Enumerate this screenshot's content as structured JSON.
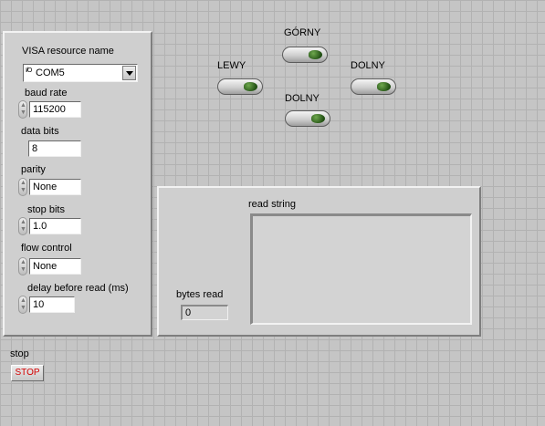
{
  "serial_settings": {
    "visa_label": "VISA resource name",
    "visa_icon_text": "I/O",
    "visa_value": "COM5",
    "baud_label": "baud rate",
    "baud_value": "115200",
    "data_bits_label": "data bits",
    "data_bits_value": "8",
    "parity_label": "parity",
    "parity_value": "None",
    "stop_bits_label": "stop bits",
    "stop_bits_value": "1.0",
    "flow_label": "flow control",
    "flow_value": "None",
    "delay_label": "delay before read (ms)",
    "delay_value": "10"
  },
  "direction_buttons": {
    "up_label": "GÓRNY",
    "left_label": "LEWY",
    "right_label": "DOLNY",
    "down_label": "DOLNY"
  },
  "read_panel": {
    "read_string_label": "read string",
    "read_string_value": "",
    "bytes_read_label": "bytes read",
    "bytes_read_value": "0"
  },
  "stop": {
    "label": "stop",
    "button_text": "STOP",
    "button_text_color": "#d40000"
  },
  "colors": {
    "led_green": "#2f6e1c",
    "background": "#c5c5c5"
  }
}
